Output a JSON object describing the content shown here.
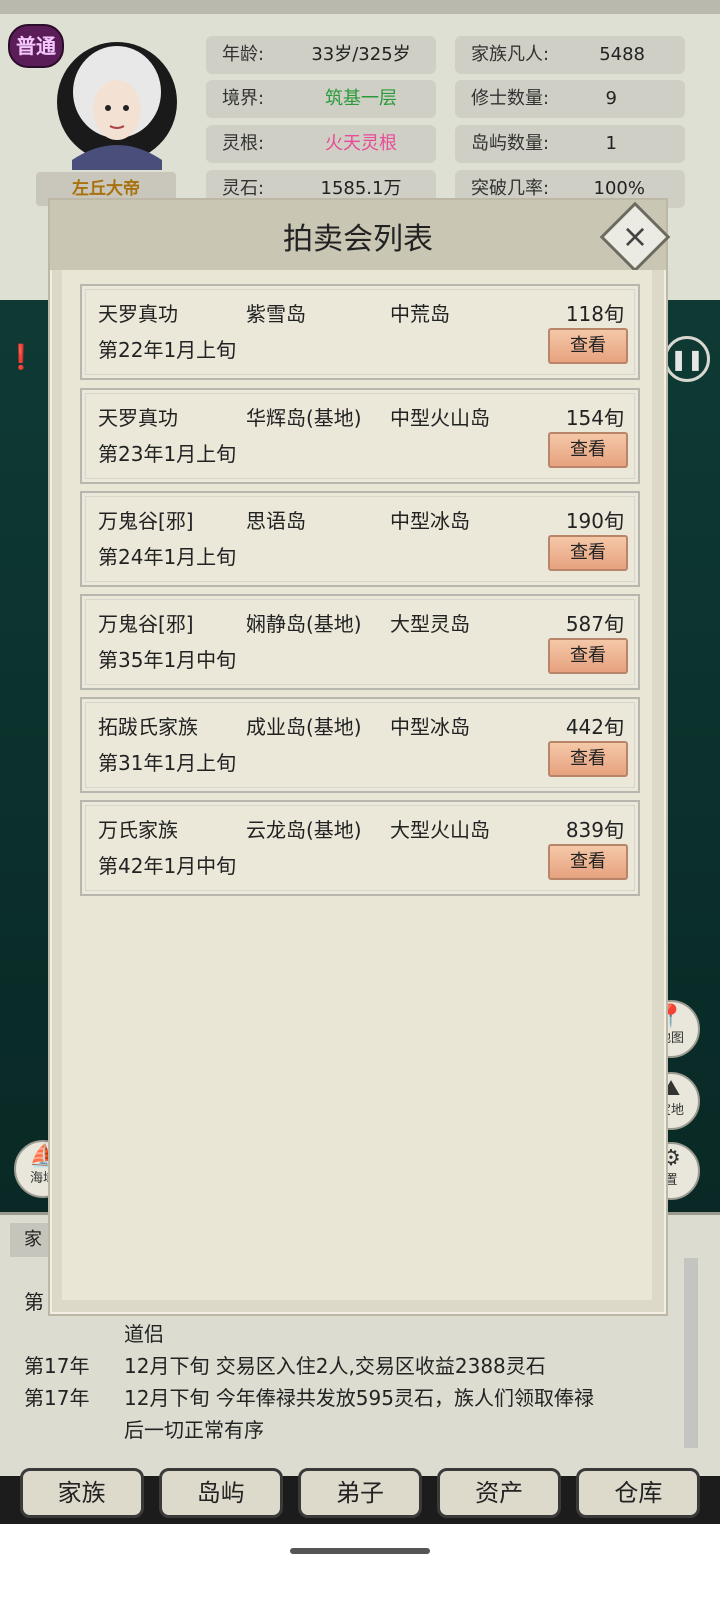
{
  "top_stats": {
    "badge": "普通",
    "player_name": "左丘大帝",
    "age_label": "年龄:",
    "age_value": "33岁/325岁",
    "realm_label": "境界:",
    "realm_value": "筑基一层",
    "root_label": "灵根:",
    "root_value": "火天灵根",
    "stones_label": "灵石:",
    "stones_value": "1585.1万",
    "clan_label": "家族凡人:",
    "clan_value": "5488",
    "cultivator_label": "修士数量:",
    "cultivator_value": "9",
    "islands_label": "岛屿数量:",
    "islands_value": "1",
    "breakthrough_label": "突破几率:",
    "breakthrough_value": "100%"
  },
  "side_icons": {
    "sea_label": "海域",
    "map_label": "地图",
    "base_label": "宝地",
    "settings_label": "置"
  },
  "modal": {
    "title": "拍卖会列表",
    "view_label": "查看",
    "items": [
      {
        "sect": "天罗真功",
        "island": "紫雪岛",
        "type": "中荒岛",
        "distance": "118旬",
        "date": "第22年1月上旬"
      },
      {
        "sect": "天罗真功",
        "island": "华辉岛(基地)",
        "type": "中型火山岛",
        "distance": "154旬",
        "date": "第23年1月上旬"
      },
      {
        "sect": "万鬼谷[邪]",
        "island": "思语岛",
        "type": "中型冰岛",
        "distance": "190旬",
        "date": "第24年1月上旬"
      },
      {
        "sect": "万鬼谷[邪]",
        "island": "娴静岛(基地)",
        "type": "大型灵岛",
        "distance": "587旬",
        "date": "第35年1月中旬"
      },
      {
        "sect": "拓跋氏家族",
        "island": "成业岛(基地)",
        "type": "中型冰岛",
        "distance": "442旬",
        "date": "第31年1月上旬"
      },
      {
        "sect": "万氏家族",
        "island": "云龙岛(基地)",
        "type": "大型火山岛",
        "distance": "839旬",
        "date": "第42年1月中旬"
      }
    ]
  },
  "log": {
    "tab": "家",
    "lines": [
      {
        "year": "第",
        "text": ""
      },
      {
        "year": "",
        "text": "道侣"
      },
      {
        "year": "第17年",
        "text": "12月下旬 交易区入住2人,交易区收益2388灵石"
      },
      {
        "year": "第17年",
        "text": "12月下旬 今年俸禄共发放595灵石，族人们领取俸禄"
      },
      {
        "year": "",
        "text": "后一切正常有序"
      }
    ]
  },
  "nav": {
    "family": "家族",
    "islands": "岛屿",
    "disciples": "弟子",
    "assets": "资产",
    "warehouse": "仓库"
  }
}
